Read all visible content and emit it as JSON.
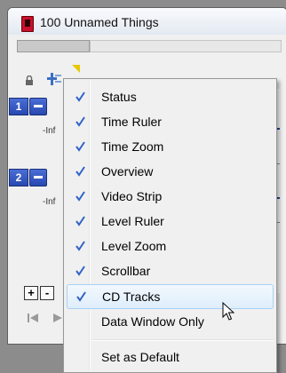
{
  "window": {
    "title": "100 Unnamed Things"
  },
  "tracks": [
    {
      "number": "1",
      "label": "-Inf"
    },
    {
      "number": "2",
      "label": "-Inf"
    }
  ],
  "track_buttons": {
    "add": "+",
    "remove": "-"
  },
  "menu": {
    "items": [
      {
        "label": "Status",
        "checked": true
      },
      {
        "label": "Time Ruler",
        "checked": true
      },
      {
        "label": "Time Zoom",
        "checked": true
      },
      {
        "label": "Overview",
        "checked": true
      },
      {
        "label": "Video Strip",
        "checked": true
      },
      {
        "label": "Level Ruler",
        "checked": true
      },
      {
        "label": "Level Zoom",
        "checked": true
      },
      {
        "label": "Scrollbar",
        "checked": true
      },
      {
        "label": "CD Tracks",
        "checked": true,
        "hover": true
      },
      {
        "label": "Data Window Only",
        "checked": false
      }
    ],
    "default_item": {
      "label": "Set as Default"
    }
  },
  "colors": {
    "accent": "#2f51c2",
    "check": "#3263c8",
    "hover_border": "#a9d1f5"
  },
  "icons": {
    "lock": "lock-icon",
    "sort": "sort-icon",
    "check": "checkmark-icon",
    "cursor": "mouse-pointer-icon",
    "prev": "skip-back-icon",
    "play": "play-icon"
  }
}
